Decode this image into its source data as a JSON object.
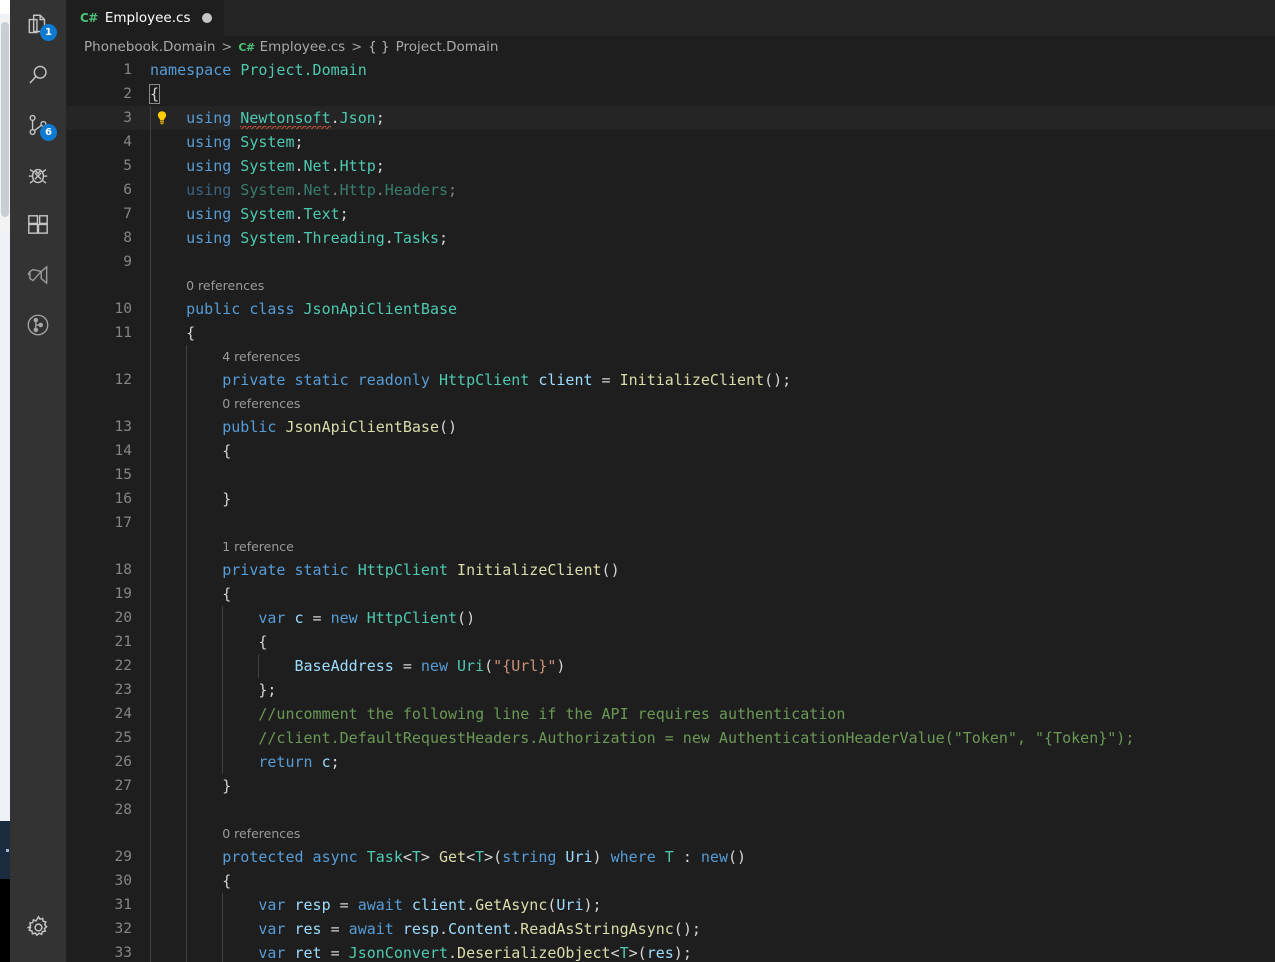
{
  "activity_bar": {
    "items": [
      {
        "name": "explorer",
        "icon": "files-icon",
        "badge": "1"
      },
      {
        "name": "search",
        "icon": "search-icon",
        "badge": null
      },
      {
        "name": "source-control",
        "icon": "source-control-icon",
        "badge": "6"
      },
      {
        "name": "run-and-debug",
        "icon": "debug-icon",
        "badge": null
      },
      {
        "name": "extensions",
        "icon": "extensions-icon",
        "badge": null
      },
      {
        "name": "visual-studio",
        "icon": "vs-ribbon-icon",
        "badge": null
      },
      {
        "name": "git-graph",
        "icon": "git-graph-icon",
        "badge": null
      }
    ],
    "bottom_items": [
      {
        "name": "manage-settings",
        "icon": "gear-icon",
        "badge": null
      }
    ],
    "badge_color": "#0e7ad1"
  },
  "tabs": [
    {
      "label": "Employee.cs",
      "language_icon": "csharp-icon",
      "dirty": true,
      "active": true
    }
  ],
  "breadcrumb": {
    "segments": [
      {
        "text": "Phonebook.Domain",
        "icon": null
      },
      {
        "text": "Employee.cs",
        "icon": "csharp-icon"
      },
      {
        "text": "Project.Domain",
        "icon": "braces-icon"
      }
    ],
    "separator": ">"
  },
  "editor": {
    "language": "C#",
    "theme": "Dark+",
    "colors": {
      "background": "#1e1e1e",
      "keyword": "#569cd6",
      "type": "#4ec9b0",
      "variable": "#9cdcfe",
      "method": "#dcdcaa",
      "string": "#ce9178",
      "comment": "#6a9955",
      "line_number": "#858585",
      "codelens": "#9a9a9a",
      "error_squiggle": "#c0573a"
    },
    "code_action_lightbulb_line": 3,
    "current_line": 3,
    "cursor_line": 2,
    "lines": [
      {
        "n": "1",
        "indent": 0,
        "tokens": [
          {
            "c": "k",
            "t": "namespace"
          },
          {
            "c": "p",
            "t": " "
          },
          {
            "c": "ns",
            "t": "Project.Domain"
          }
        ]
      },
      {
        "n": "2",
        "indent": 0,
        "cursor": true,
        "tokens": [
          {
            "c": "p",
            "t": "{"
          }
        ]
      },
      {
        "n": "3",
        "indent": 1,
        "bulb": true,
        "current": true,
        "tokens": [
          {
            "c": "k",
            "t": "using"
          },
          {
            "c": "p",
            "t": " "
          },
          {
            "c": "ns sq",
            "t": "Newtonsoft"
          },
          {
            "c": "p",
            "t": "."
          },
          {
            "c": "ns",
            "t": "Json"
          },
          {
            "c": "p",
            "t": ";"
          }
        ]
      },
      {
        "n": "4",
        "indent": 1,
        "tokens": [
          {
            "c": "k",
            "t": "using"
          },
          {
            "c": "p",
            "t": " "
          },
          {
            "c": "ns",
            "t": "System"
          },
          {
            "c": "p",
            "t": ";"
          }
        ]
      },
      {
        "n": "5",
        "indent": 1,
        "tokens": [
          {
            "c": "k",
            "t": "using"
          },
          {
            "c": "p",
            "t": " "
          },
          {
            "c": "ns",
            "t": "System"
          },
          {
            "c": "p",
            "t": "."
          },
          {
            "c": "ns",
            "t": "Net"
          },
          {
            "c": "p",
            "t": "."
          },
          {
            "c": "ns",
            "t": "Http"
          },
          {
            "c": "p",
            "t": ";"
          }
        ]
      },
      {
        "n": "6",
        "indent": 1,
        "dim": true,
        "tokens": [
          {
            "c": "k",
            "t": "using"
          },
          {
            "c": "p",
            "t": " "
          },
          {
            "c": "ns",
            "t": "System"
          },
          {
            "c": "p",
            "t": "."
          },
          {
            "c": "ns",
            "t": "Net"
          },
          {
            "c": "p",
            "t": "."
          },
          {
            "c": "ns",
            "t": "Http"
          },
          {
            "c": "p",
            "t": "."
          },
          {
            "c": "ns",
            "t": "Headers"
          },
          {
            "c": "p",
            "t": ";"
          }
        ]
      },
      {
        "n": "7",
        "indent": 1,
        "tokens": [
          {
            "c": "k",
            "t": "using"
          },
          {
            "c": "p",
            "t": " "
          },
          {
            "c": "ns",
            "t": "System"
          },
          {
            "c": "p",
            "t": "."
          },
          {
            "c": "ns",
            "t": "Text"
          },
          {
            "c": "p",
            "t": ";"
          }
        ]
      },
      {
        "n": "8",
        "indent": 1,
        "tokens": [
          {
            "c": "k",
            "t": "using"
          },
          {
            "c": "p",
            "t": " "
          },
          {
            "c": "ns",
            "t": "System"
          },
          {
            "c": "p",
            "t": "."
          },
          {
            "c": "ns",
            "t": "Threading"
          },
          {
            "c": "p",
            "t": "."
          },
          {
            "c": "ns",
            "t": "Tasks"
          },
          {
            "c": "p",
            "t": ";"
          }
        ]
      },
      {
        "n": "9",
        "indent": 1,
        "tokens": []
      },
      {
        "lens": "0 references",
        "indent": 1
      },
      {
        "n": "10",
        "indent": 1,
        "tokens": [
          {
            "c": "k",
            "t": "public"
          },
          {
            "c": "p",
            "t": " "
          },
          {
            "c": "k",
            "t": "class"
          },
          {
            "c": "p",
            "t": " "
          },
          {
            "c": "t",
            "t": "JsonApiClientBase"
          }
        ]
      },
      {
        "n": "11",
        "indent": 1,
        "tokens": [
          {
            "c": "p",
            "t": "{"
          }
        ]
      },
      {
        "lens": "4 references",
        "indent": 2
      },
      {
        "n": "12",
        "indent": 2,
        "tokens": [
          {
            "c": "k",
            "t": "private"
          },
          {
            "c": "p",
            "t": " "
          },
          {
            "c": "k",
            "t": "static"
          },
          {
            "c": "p",
            "t": " "
          },
          {
            "c": "k",
            "t": "readonly"
          },
          {
            "c": "p",
            "t": " "
          },
          {
            "c": "t",
            "t": "HttpClient"
          },
          {
            "c": "p",
            "t": " "
          },
          {
            "c": "v",
            "t": "client"
          },
          {
            "c": "p",
            "t": " = "
          },
          {
            "c": "m",
            "t": "InitializeClient"
          },
          {
            "c": "p",
            "t": "();"
          }
        ]
      },
      {
        "lens": "0 references",
        "indent": 2
      },
      {
        "n": "13",
        "indent": 2,
        "tokens": [
          {
            "c": "k",
            "t": "public"
          },
          {
            "c": "p",
            "t": " "
          },
          {
            "c": "m",
            "t": "JsonApiClientBase"
          },
          {
            "c": "p",
            "t": "()"
          }
        ]
      },
      {
        "n": "14",
        "indent": 2,
        "tokens": [
          {
            "c": "p",
            "t": "{"
          }
        ]
      },
      {
        "n": "15",
        "indent": 2,
        "tokens": []
      },
      {
        "n": "16",
        "indent": 2,
        "tokens": [
          {
            "c": "p",
            "t": "}"
          }
        ]
      },
      {
        "n": "17",
        "indent": 2,
        "tokens": []
      },
      {
        "lens": "1 reference",
        "indent": 2
      },
      {
        "n": "18",
        "indent": 2,
        "tokens": [
          {
            "c": "k",
            "t": "private"
          },
          {
            "c": "p",
            "t": " "
          },
          {
            "c": "k",
            "t": "static"
          },
          {
            "c": "p",
            "t": " "
          },
          {
            "c": "t",
            "t": "HttpClient"
          },
          {
            "c": "p",
            "t": " "
          },
          {
            "c": "m",
            "t": "InitializeClient"
          },
          {
            "c": "p",
            "t": "()"
          }
        ]
      },
      {
        "n": "19",
        "indent": 2,
        "tokens": [
          {
            "c": "p",
            "t": "{"
          }
        ]
      },
      {
        "n": "20",
        "indent": 3,
        "tokens": [
          {
            "c": "k",
            "t": "var"
          },
          {
            "c": "p",
            "t": " "
          },
          {
            "c": "v",
            "t": "c"
          },
          {
            "c": "p",
            "t": " = "
          },
          {
            "c": "k",
            "t": "new"
          },
          {
            "c": "p",
            "t": " "
          },
          {
            "c": "t",
            "t": "HttpClient"
          },
          {
            "c": "p",
            "t": "()"
          }
        ]
      },
      {
        "n": "21",
        "indent": 3,
        "tokens": [
          {
            "c": "p",
            "t": "{"
          }
        ]
      },
      {
        "n": "22",
        "indent": 4,
        "tokens": [
          {
            "c": "v",
            "t": "BaseAddress"
          },
          {
            "c": "p",
            "t": " = "
          },
          {
            "c": "k",
            "t": "new"
          },
          {
            "c": "p",
            "t": " "
          },
          {
            "c": "t",
            "t": "Uri"
          },
          {
            "c": "p",
            "t": "("
          },
          {
            "c": "s",
            "t": "\"{Url}\""
          },
          {
            "c": "p",
            "t": ")"
          }
        ]
      },
      {
        "n": "23",
        "indent": 3,
        "tokens": [
          {
            "c": "p",
            "t": "};"
          }
        ]
      },
      {
        "n": "24",
        "indent": 3,
        "tokens": [
          {
            "c": "c",
            "t": "//uncomment the following line if the API requires authentication"
          }
        ]
      },
      {
        "n": "25",
        "indent": 3,
        "tokens": [
          {
            "c": "c",
            "t": "//client.DefaultRequestHeaders.Authorization = new AuthenticationHeaderValue(\"Token\", \"{Token}\");"
          }
        ]
      },
      {
        "n": "26",
        "indent": 3,
        "tokens": [
          {
            "c": "k",
            "t": "return"
          },
          {
            "c": "p",
            "t": " "
          },
          {
            "c": "v",
            "t": "c"
          },
          {
            "c": "p",
            "t": ";"
          }
        ]
      },
      {
        "n": "27",
        "indent": 2,
        "tokens": [
          {
            "c": "p",
            "t": "}"
          }
        ]
      },
      {
        "n": "28",
        "indent": 2,
        "tokens": []
      },
      {
        "lens": "0 references",
        "indent": 2
      },
      {
        "n": "29",
        "indent": 2,
        "tokens": [
          {
            "c": "k",
            "t": "protected"
          },
          {
            "c": "p",
            "t": " "
          },
          {
            "c": "k",
            "t": "async"
          },
          {
            "c": "p",
            "t": " "
          },
          {
            "c": "t",
            "t": "Task"
          },
          {
            "c": "p",
            "t": "<"
          },
          {
            "c": "t",
            "t": "T"
          },
          {
            "c": "p",
            "t": "> "
          },
          {
            "c": "m",
            "t": "Get"
          },
          {
            "c": "p",
            "t": "<"
          },
          {
            "c": "t",
            "t": "T"
          },
          {
            "c": "p",
            "t": ">("
          },
          {
            "c": "k",
            "t": "string"
          },
          {
            "c": "p",
            "t": " "
          },
          {
            "c": "v",
            "t": "Uri"
          },
          {
            "c": "p",
            "t": ") "
          },
          {
            "c": "k",
            "t": "where"
          },
          {
            "c": "p",
            "t": " "
          },
          {
            "c": "t",
            "t": "T"
          },
          {
            "c": "p",
            "t": " : "
          },
          {
            "c": "k",
            "t": "new"
          },
          {
            "c": "p",
            "t": "()"
          }
        ]
      },
      {
        "n": "30",
        "indent": 2,
        "tokens": [
          {
            "c": "p",
            "t": "{"
          }
        ]
      },
      {
        "n": "31",
        "indent": 3,
        "tokens": [
          {
            "c": "k",
            "t": "var"
          },
          {
            "c": "p",
            "t": " "
          },
          {
            "c": "v",
            "t": "resp"
          },
          {
            "c": "p",
            "t": " = "
          },
          {
            "c": "k",
            "t": "await"
          },
          {
            "c": "p",
            "t": " "
          },
          {
            "c": "v",
            "t": "client"
          },
          {
            "c": "p",
            "t": "."
          },
          {
            "c": "m",
            "t": "GetAsync"
          },
          {
            "c": "p",
            "t": "("
          },
          {
            "c": "v",
            "t": "Uri"
          },
          {
            "c": "p",
            "t": ");"
          }
        ]
      },
      {
        "n": "32",
        "indent": 3,
        "tokens": [
          {
            "c": "k",
            "t": "var"
          },
          {
            "c": "p",
            "t": " "
          },
          {
            "c": "v",
            "t": "res"
          },
          {
            "c": "p",
            "t": " = "
          },
          {
            "c": "k",
            "t": "await"
          },
          {
            "c": "p",
            "t": " "
          },
          {
            "c": "v",
            "t": "resp"
          },
          {
            "c": "p",
            "t": "."
          },
          {
            "c": "v",
            "t": "Content"
          },
          {
            "c": "p",
            "t": "."
          },
          {
            "c": "m",
            "t": "ReadAsStringAsync"
          },
          {
            "c": "p",
            "t": "();"
          }
        ]
      },
      {
        "n": "33",
        "indent": 3,
        "tokens": [
          {
            "c": "k",
            "t": "var"
          },
          {
            "c": "p",
            "t": " "
          },
          {
            "c": "v",
            "t": "ret"
          },
          {
            "c": "p",
            "t": " = "
          },
          {
            "c": "t",
            "t": "JsonConvert"
          },
          {
            "c": "p",
            "t": "."
          },
          {
            "c": "m",
            "t": "DeserializeObject"
          },
          {
            "c": "p",
            "t": "<"
          },
          {
            "c": "t",
            "t": "T"
          },
          {
            "c": "p",
            "t": ">("
          },
          {
            "c": "v",
            "t": "res"
          },
          {
            "c": "p",
            "t": ");"
          }
        ]
      }
    ]
  }
}
